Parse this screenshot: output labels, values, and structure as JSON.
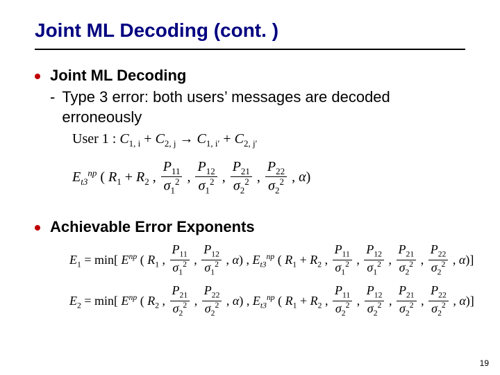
{
  "title": "Joint ML Decoding (cont. )",
  "b1": {
    "heading": "Joint ML Decoding",
    "sub": "Type 3 error: both users’ messages are decoded erroneously"
  },
  "f_user1_label": "User 1 :",
  "f_user1_lhs_a": "C",
  "f_user1_lhs_a_sub": "1, i",
  "f_user1_plus": " + ",
  "f_user1_lhs_b": "C",
  "f_user1_lhs_b_sub": "2, j",
  "f_user1_arrow": " → ",
  "f_user1_rhs_a": "C",
  "f_user1_rhs_a_sub": "1, i′",
  "f_user1_rhs_b": "C",
  "f_user1_rhs_b_sub": "2, j′",
  "f_et3_E": "E",
  "f_et3_sup": "np",
  "f_et3_sub": "t3",
  "f_et3_open": "(",
  "f_R1": "R",
  "f_R1_sub": "1",
  "f_R2": "R",
  "f_R2_sub": "2",
  "f_comma": " , ",
  "P11_n": "P",
  "P11_ns": "11",
  "P12_n": "P",
  "P12_ns": "12",
  "P21_n": "P",
  "P21_ns": "21",
  "P22_n": "P",
  "P22_ns": "22",
  "sig": "σ",
  "sig1_sq_sub": "1",
  "sig2_sq_sub": "2",
  "sq": "2",
  "alpha": "α",
  "close": ")",
  "close_br": ")]",
  "b2": {
    "heading": "Achievable Error Exponents"
  },
  "E1_lhs": "E",
  "E1_lhs_sub": "1",
  "E2_lhs": "E",
  "E2_lhs_sub": "2",
  "eq_min": " = min[",
  "Enp": "E",
  "Enp_sup": "np",
  "page": "19"
}
